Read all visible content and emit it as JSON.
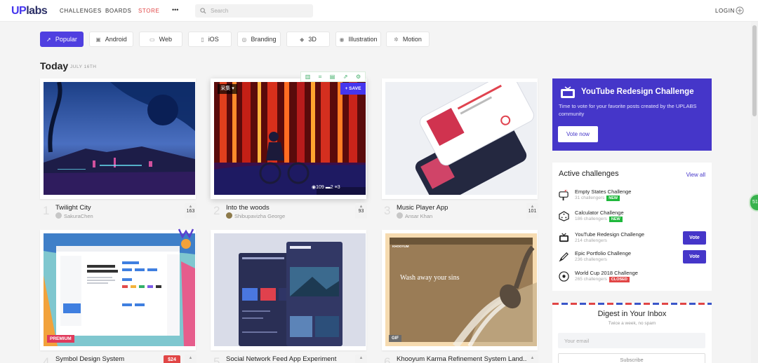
{
  "header": {
    "logo": {
      "prefix": "UP",
      "suffix": "labs"
    },
    "nav": [
      "CHALLENGES",
      "BOARDS",
      "STORE"
    ],
    "more_label": "•••",
    "search_placeholder": "Search",
    "login_label": "LOGIN"
  },
  "filters": [
    {
      "label": "Popular",
      "icon": "popular-icon",
      "active": true
    },
    {
      "label": "Android",
      "icon": "android-icon",
      "active": false
    },
    {
      "label": "Web",
      "icon": "monitor-icon",
      "active": false
    },
    {
      "label": "iOS",
      "icon": "phone-icon",
      "active": false
    },
    {
      "label": "Branding",
      "icon": "branding-icon",
      "active": false
    },
    {
      "label": "3D",
      "icon": "cube-icon",
      "active": false
    },
    {
      "label": "Illustration",
      "icon": "palette-icon",
      "active": false
    },
    {
      "label": "Motion",
      "icon": "motion-icon",
      "active": false
    }
  ],
  "section": {
    "title": "Today",
    "date": "JULY 16TH"
  },
  "cards": [
    {
      "rank": "1",
      "title": "Twilight City",
      "author": "SakuraChen",
      "votes": "163"
    },
    {
      "rank": "2",
      "title": "Into the woods",
      "author": "Shibupavizha George",
      "votes": "93",
      "stats": {
        "views": "109",
        "comments": "2",
        "likes": "3"
      },
      "save_label": "+ SAVE",
      "board_label": "采集"
    },
    {
      "rank": "3",
      "title": "Music Player App",
      "author": "Ansar Khan",
      "votes": "101"
    },
    {
      "rank": "4",
      "title": "Symbol Design System",
      "tag": "PREMIUM",
      "price": "$24"
    },
    {
      "rank": "5",
      "title": "Social Network Feed App Experiment"
    },
    {
      "rank": "6",
      "title": "Khooyum Karma Refinement System Land...",
      "tag": "GIF",
      "mockup_text": "Wash away your sins"
    }
  ],
  "promo": {
    "title": "YouTube Redesign Challenge",
    "desc": "Time to vote for your favorite posts created by the UPLABS community",
    "button": "Vote now"
  },
  "challenges": {
    "title": "Active challenges",
    "view_all": "View all",
    "items": [
      {
        "name": "Empty States Challenge",
        "meta": "31 challengers",
        "badge": "NEW",
        "badge_color": "#1fb83c",
        "icon": "mailbox-icon"
      },
      {
        "name": "Calculator Challenge",
        "meta": "186 challengers",
        "badge": "NEW",
        "badge_color": "#1fb83c",
        "icon": "dice-icon"
      },
      {
        "name": "YouTube Redesign Challenge",
        "meta": "214 challengers",
        "vote": "Vote",
        "icon": "tv-icon"
      },
      {
        "name": "Epic Portfolio Challenge",
        "meta": "236 challengers",
        "vote": "Vote",
        "icon": "pencil-icon"
      },
      {
        "name": "World Cup 2018 Challenge",
        "meta": "265 challengers",
        "badge": "CLOSED",
        "badge_color": "#e14646",
        "icon": "soccer-ball-icon"
      }
    ]
  },
  "digest": {
    "title": "Digest in Your Inbox",
    "subtitle": "Twice a week, no spam",
    "email_placeholder": "Your email",
    "subscribe": "Subscribe"
  },
  "colors": {
    "brand": "#4536ee",
    "accent_red": "#e14646",
    "badge_green": "#1fb83c"
  }
}
